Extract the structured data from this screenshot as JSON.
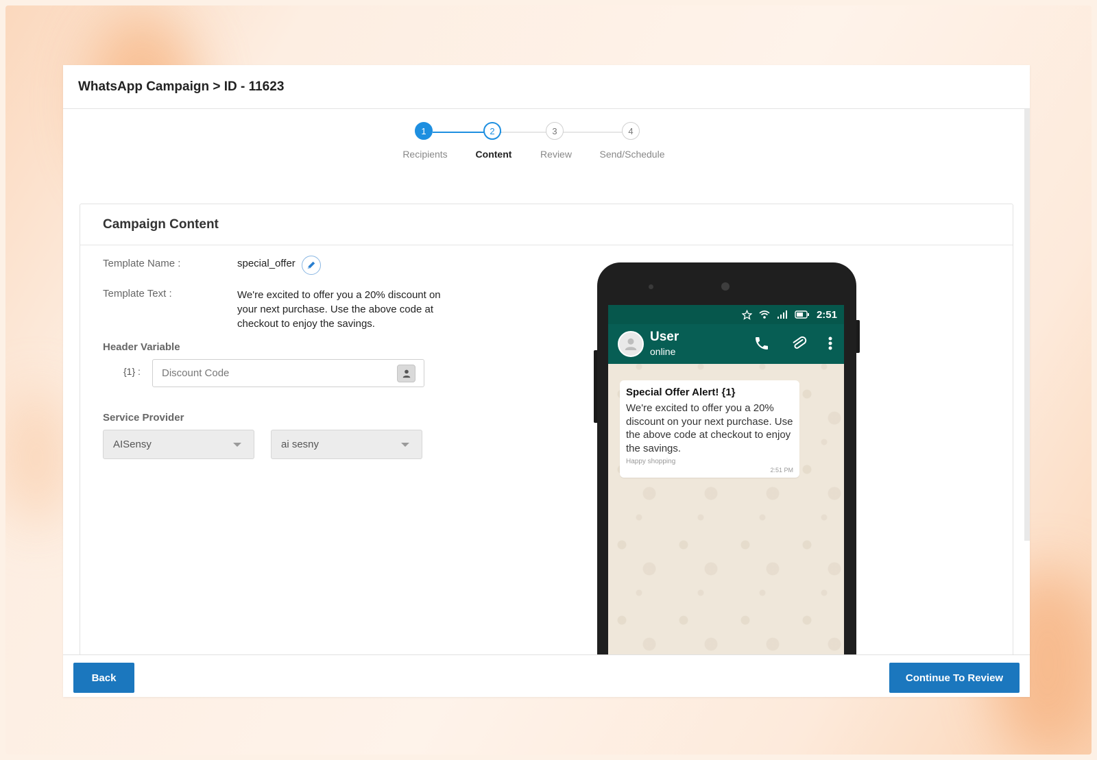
{
  "header": {
    "title": "WhatsApp Campaign > ID - 11623"
  },
  "stepper": {
    "steps": [
      {
        "number": "1",
        "label": "Recipients",
        "state": "done"
      },
      {
        "number": "2",
        "label": "Content",
        "state": "active"
      },
      {
        "number": "3",
        "label": "Review",
        "state": "pending"
      },
      {
        "number": "4",
        "label": "Send/Schedule",
        "state": "pending"
      }
    ]
  },
  "content": {
    "title": "Campaign Content",
    "template_name_label": "Template Name :",
    "template_name_value": "special_offer",
    "template_text_label": "Template Text :",
    "template_text_value": "We're excited to offer you a 20% discount on your next purchase. Use the above code at checkout to enjoy the savings.",
    "header_variable_label": "Header Variable",
    "variable_key": "{1} :",
    "variable_placeholder": "Discount Code",
    "service_provider_label": "Service Provider",
    "provider_value": "AISensy",
    "account_value": "ai sesny"
  },
  "preview": {
    "time": "2:51",
    "user_name": "User",
    "user_status": "online",
    "message_header": "Special Offer Alert! {1}",
    "message_body": "We're excited to offer you a 20% discount on your next purchase. Use the above code at checkout to enjoy the savings.",
    "message_footer": "Happy shopping",
    "message_time": "2:51 PM"
  },
  "footer": {
    "back_label": "Back",
    "continue_label": "Continue To Review"
  },
  "colors": {
    "primary": "#1b77be",
    "step_active": "#1e8fe0",
    "whatsapp_header": "#075e54"
  },
  "icons": [
    "edit-icon",
    "contact-icon",
    "star-icon",
    "wifi-icon",
    "signal-icon",
    "battery-icon",
    "phone-call-icon",
    "attach-icon",
    "more-vertical-icon",
    "user-avatar-icon"
  ]
}
